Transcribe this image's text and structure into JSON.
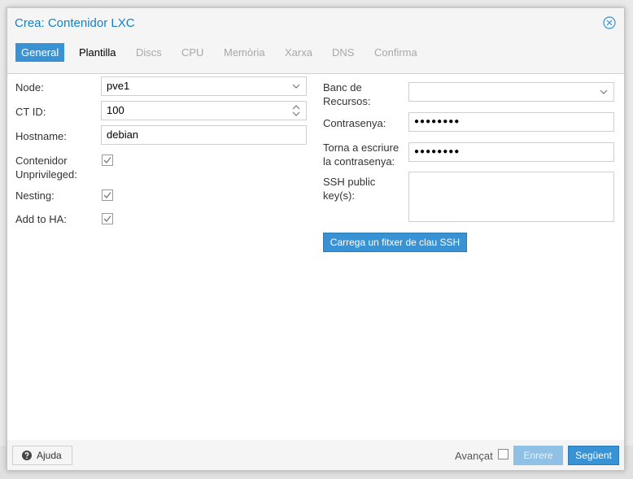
{
  "window": {
    "title": "Crea: Contenidor LXC"
  },
  "tabs": [
    {
      "label": "General",
      "state": "active"
    },
    {
      "label": "Plantilla",
      "state": "enabled"
    },
    {
      "label": "Discs",
      "state": "disabled"
    },
    {
      "label": "CPU",
      "state": "disabled"
    },
    {
      "label": "Memòria",
      "state": "disabled"
    },
    {
      "label": "Xarxa",
      "state": "disabled"
    },
    {
      "label": "DNS",
      "state": "disabled"
    },
    {
      "label": "Confirma",
      "state": "disabled"
    }
  ],
  "left": {
    "node": {
      "label": "Node:",
      "value": "pve1"
    },
    "ctid": {
      "label": "CT ID:",
      "value": "100"
    },
    "hostname": {
      "label": "Hostname:",
      "value": "debian"
    },
    "unprivileged": {
      "label1": "Contenidor",
      "label2": "Unprivileged:",
      "checked": true
    },
    "nesting": {
      "label": "Nesting:",
      "checked": true
    },
    "ha": {
      "label": "Add to HA:",
      "checked": true
    }
  },
  "right": {
    "pool": {
      "label1": "Banc de",
      "label2": "Recursos:",
      "value": ""
    },
    "password": {
      "label": "Contrasenya:",
      "value": "●●●●●●●●"
    },
    "confirm": {
      "label1": "Torna a escriure",
      "label2": "la contrasenya:",
      "value": "●●●●●●●●"
    },
    "sshkey": {
      "label1": "SSH public",
      "label2": "key(s):",
      "value": ""
    },
    "load_ssh_button": "Carrega un fitxer de clau SSH"
  },
  "footer": {
    "help_label": "Ajuda",
    "advanced_label": "Avançat",
    "advanced_checked": false,
    "back_label": "Enrere",
    "next_label": "Següent"
  },
  "colors": {
    "accent": "#3892d4",
    "title": "#157fcc"
  }
}
